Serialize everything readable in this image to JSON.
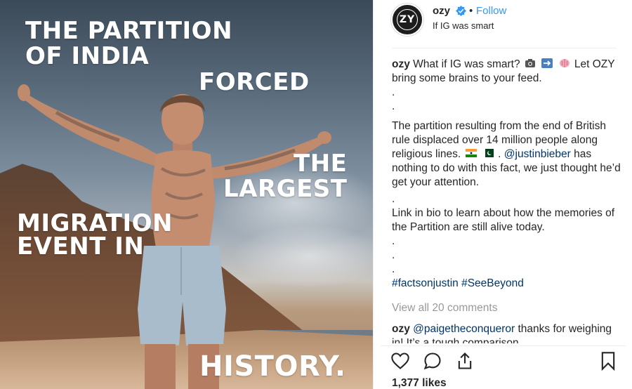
{
  "image": {
    "overlay_lines": [
      "THE PARTITION OF INDIA",
      "FORCED",
      "THE",
      "LARGEST",
      "MIGRATION",
      "EVENT IN",
      "HISTORY."
    ]
  },
  "header": {
    "username": "ozy",
    "separator": "•",
    "follow_label": "Follow",
    "location": "If IG was smart",
    "avatar_text": "ZY",
    "verified_color": "#3897f0"
  },
  "caption": {
    "username": "ozy",
    "line1": "What if IG was smart?",
    "line1_tail": "Let OZY bring some brains to your feed.",
    "dots_a": [
      ".",
      "."
    ],
    "body": "The partition resulting from the end of British rule displaced over 14 million people along religious lines.",
    "mention": "@justinbieber",
    "mention_prefix": ".",
    "body_tail": "has nothing to do with this fact, we just thought he’d get your attention.",
    "dot_b": ".",
    "body2": "Link in bio to learn about how the memories of the Partition are still alive today.",
    "dots_c": [
      ".",
      ".",
      "."
    ],
    "hashtags": "#factsonjustin #SeeBeyond",
    "emoji_icons": [
      "camera-icon",
      "arrow-right-icon",
      "brain-icon",
      "india-flag-icon",
      "pakistan-flag-icon"
    ]
  },
  "comments": {
    "view_all": "View all 20 comments",
    "items": [
      {
        "username": "ozy",
        "mention": "@paigetheconqueror",
        "text": "thanks for weighing in! It’s a tough comparison"
      }
    ]
  },
  "actions": {
    "icons": [
      "heart-icon",
      "comment-icon",
      "share-icon",
      "bookmark-icon"
    ],
    "likes": "1,377 likes"
  },
  "colors": {
    "link": "#003569",
    "follow": "#3897f0",
    "muted": "#999999"
  }
}
